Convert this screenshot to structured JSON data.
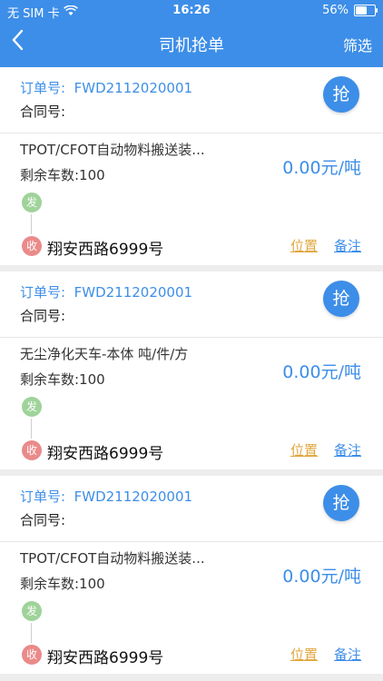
{
  "status": {
    "carrier": "无 SIM 卡",
    "time": "16:26",
    "battery": "56%"
  },
  "nav": {
    "back_label": "‹",
    "title": "司机抢单",
    "filter": "筛选"
  },
  "orders": [
    {
      "order_label": "订单号:",
      "order_no": "FWD2112020001",
      "contract_label": "合同号:",
      "grab": "抢",
      "goods": "TPOT/CFOT自动物料搬送装...",
      "remain": "剩余车数:100",
      "price": "0.00元/吨",
      "from_tag": "发",
      "to_tag": "收",
      "to_address": "翔安西路6999号",
      "loc_label": "位置",
      "note_label": "备注"
    },
    {
      "order_label": "订单号:",
      "order_no": "FWD2112020001",
      "contract_label": "合同号:",
      "grab": "抢",
      "goods": "无尘净化天车-本体 吨/件/方",
      "remain": "剩余车数:100",
      "price": "0.00元/吨",
      "from_tag": "发",
      "to_tag": "收",
      "to_address": "翔安西路6999号",
      "loc_label": "位置",
      "note_label": "备注"
    },
    {
      "order_label": "订单号:",
      "order_no": "FWD2112020001",
      "contract_label": "合同号:",
      "grab": "抢",
      "goods": "TPOT/CFOT自动物料搬送装...",
      "remain": "剩余车数:100",
      "price": "0.00元/吨",
      "from_tag": "发",
      "to_tag": "收",
      "to_address": "翔安西路6999号",
      "loc_label": "位置",
      "note_label": "备注"
    }
  ],
  "colors": {
    "primary": "#3d8ee8",
    "accent": "#e0a63c",
    "from": "#9fd39a",
    "to": "#ea8a8a"
  }
}
